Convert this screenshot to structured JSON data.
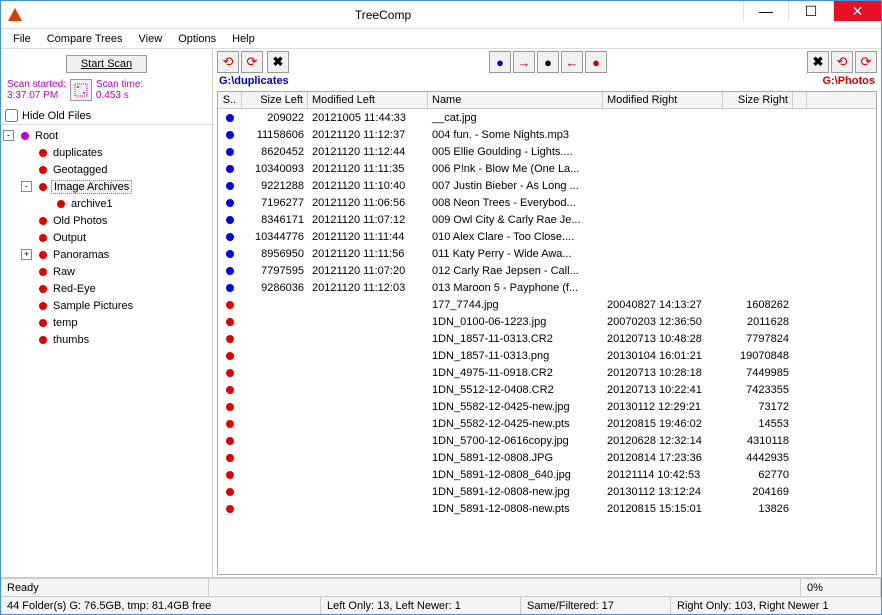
{
  "window": {
    "title": "TreeComp"
  },
  "menu": {
    "file": "File",
    "compare": "Compare Trees",
    "view": "View",
    "options": "Options",
    "help": "Help"
  },
  "scan": {
    "button": "Start Scan",
    "started_label": "Scan started:",
    "started_time": "3:37:07 PM",
    "time_label": "Scan time:",
    "time_value": "0.453 s",
    "hide_old": "Hide Old Files"
  },
  "tree": {
    "root": "Root",
    "nodes": [
      {
        "label": "duplicates",
        "indent": 1,
        "toggle": "",
        "color": "red"
      },
      {
        "label": "Geotagged",
        "indent": 1,
        "toggle": "",
        "color": "red"
      },
      {
        "label": "Image Archives",
        "indent": 1,
        "toggle": "-",
        "color": "red",
        "selected": true
      },
      {
        "label": "archive1",
        "indent": 2,
        "toggle": "",
        "color": "red"
      },
      {
        "label": "Old Photos",
        "indent": 1,
        "toggle": "",
        "color": "red"
      },
      {
        "label": "Output",
        "indent": 1,
        "toggle": "",
        "color": "red"
      },
      {
        "label": "Panoramas",
        "indent": 1,
        "toggle": "+",
        "color": "red"
      },
      {
        "label": "Raw",
        "indent": 1,
        "toggle": "",
        "color": "red"
      },
      {
        "label": "Red-Eye",
        "indent": 1,
        "toggle": "",
        "color": "red"
      },
      {
        "label": "Sample Pictures",
        "indent": 1,
        "toggle": "",
        "color": "red"
      },
      {
        "label": "temp",
        "indent": 1,
        "toggle": "",
        "color": "red"
      },
      {
        "label": "thumbs",
        "indent": 1,
        "toggle": "",
        "color": "red"
      }
    ]
  },
  "paths": {
    "left": "G:\\duplicates",
    "right": "G:\\Photos"
  },
  "columns": {
    "s": "S..",
    "size_left": "Size Left",
    "mod_left": "Modified Left",
    "name": "Name",
    "mod_right": "Modified Right",
    "size_right": "Size Right"
  },
  "rows": [
    {
      "dot": "blue",
      "sl": "209022",
      "ml": "20121005 11:44:33",
      "name": "__cat.jpg",
      "mr": "",
      "sr": ""
    },
    {
      "dot": "blue",
      "sl": "11158606",
      "ml": "20121120 11:12:37",
      "name": "004 fun. - Some Nights.mp3",
      "mr": "",
      "sr": ""
    },
    {
      "dot": "blue",
      "sl": "8620452",
      "ml": "20121120 11:12:44",
      "name": "005 Ellie Goulding - Lights....",
      "mr": "",
      "sr": ""
    },
    {
      "dot": "blue",
      "sl": "10340093",
      "ml": "20121120 11:11:35",
      "name": "006 P!nk - Blow Me (One La...",
      "mr": "",
      "sr": ""
    },
    {
      "dot": "blue",
      "sl": "9221288",
      "ml": "20121120 11:10:40",
      "name": "007 Justin Bieber - As Long ...",
      "mr": "",
      "sr": ""
    },
    {
      "dot": "blue",
      "sl": "7196277",
      "ml": "20121120 11:06:56",
      "name": "008 Neon Trees - Everybod...",
      "mr": "",
      "sr": ""
    },
    {
      "dot": "blue",
      "sl": "8346171",
      "ml": "20121120 11:07:12",
      "name": "009 Owl City & Carly Rae Je...",
      "mr": "",
      "sr": ""
    },
    {
      "dot": "blue",
      "sl": "10344776",
      "ml": "20121120 11:11:44",
      "name": "010 Alex Clare - Too Close....",
      "mr": "",
      "sr": ""
    },
    {
      "dot": "blue",
      "sl": "8956950",
      "ml": "20121120 11:11:56",
      "name": "011 Katy Perry - Wide Awa...",
      "mr": "",
      "sr": ""
    },
    {
      "dot": "blue",
      "sl": "7797595",
      "ml": "20121120 11:07:20",
      "name": "012 Carly Rae Jepsen - Call...",
      "mr": "",
      "sr": ""
    },
    {
      "dot": "blue",
      "sl": "9286036",
      "ml": "20121120 11:12:03",
      "name": "013 Maroon 5 - Payphone (f...",
      "mr": "",
      "sr": ""
    },
    {
      "dot": "red",
      "sl": "",
      "ml": "",
      "name": "177_7744.jpg",
      "mr": "20040827 14:13:27",
      "sr": "1608262"
    },
    {
      "dot": "red",
      "sl": "",
      "ml": "",
      "name": "1DN_0100-06-1223.jpg",
      "mr": "20070203 12:36:50",
      "sr": "2011628"
    },
    {
      "dot": "red",
      "sl": "",
      "ml": "",
      "name": "1DN_1857-11-0313.CR2",
      "mr": "20120713 10:48:28",
      "sr": "7797824"
    },
    {
      "dot": "red",
      "sl": "",
      "ml": "",
      "name": "1DN_1857-11-0313.png",
      "mr": "20130104 16:01:21",
      "sr": "19070848"
    },
    {
      "dot": "red",
      "sl": "",
      "ml": "",
      "name": "1DN_4975-11-0918.CR2",
      "mr": "20120713 10:28:18",
      "sr": "7449985"
    },
    {
      "dot": "red",
      "sl": "",
      "ml": "",
      "name": "1DN_5512-12-0408.CR2",
      "mr": "20120713 10:22:41",
      "sr": "7423355"
    },
    {
      "dot": "red",
      "sl": "",
      "ml": "",
      "name": "1DN_5582-12-0425-new.jpg",
      "mr": "20130112 12:29:21",
      "sr": "73172"
    },
    {
      "dot": "red",
      "sl": "",
      "ml": "",
      "name": "1DN_5582-12-0425-new.pts",
      "mr": "20120815 19:46:02",
      "sr": "14553"
    },
    {
      "dot": "red",
      "sl": "",
      "ml": "",
      "name": "1DN_5700-12-0616copy.jpg",
      "mr": "20120628 12:32:14",
      "sr": "4310118"
    },
    {
      "dot": "red",
      "sl": "",
      "ml": "",
      "name": "1DN_5891-12-0808.JPG",
      "mr": "20120814 17:23:36",
      "sr": "4442935"
    },
    {
      "dot": "red",
      "sl": "",
      "ml": "",
      "name": "1DN_5891-12-0808_640.jpg",
      "mr": "20121114 10:42:53",
      "sr": "62770"
    },
    {
      "dot": "red",
      "sl": "",
      "ml": "",
      "name": "1DN_5891-12-0808-new.jpg",
      "mr": "20130112 13:12:24",
      "sr": "204169"
    },
    {
      "dot": "red",
      "sl": "",
      "ml": "",
      "name": "1DN_5891-12-0808-new.pts",
      "mr": "20120815 15:15:01",
      "sr": "13826"
    }
  ],
  "status": {
    "ready": "Ready",
    "percent": "0%"
  },
  "bottom": {
    "folders": "44 Folder(s) G: 76.5GB, tmp: 81.4GB free",
    "left_only": "Left Only: 13, Left Newer: 1",
    "same": "Same/Filtered: 17",
    "right_only": "Right Only: 103, Right Newer 1"
  },
  "icons": {
    "refresh_left": "↺",
    "refresh_right": "↻",
    "delete_x": "✖",
    "dot_blue": "●",
    "arrow_right": "→",
    "dot_black": "●",
    "arrow_left": "←",
    "dot_red": "●"
  }
}
